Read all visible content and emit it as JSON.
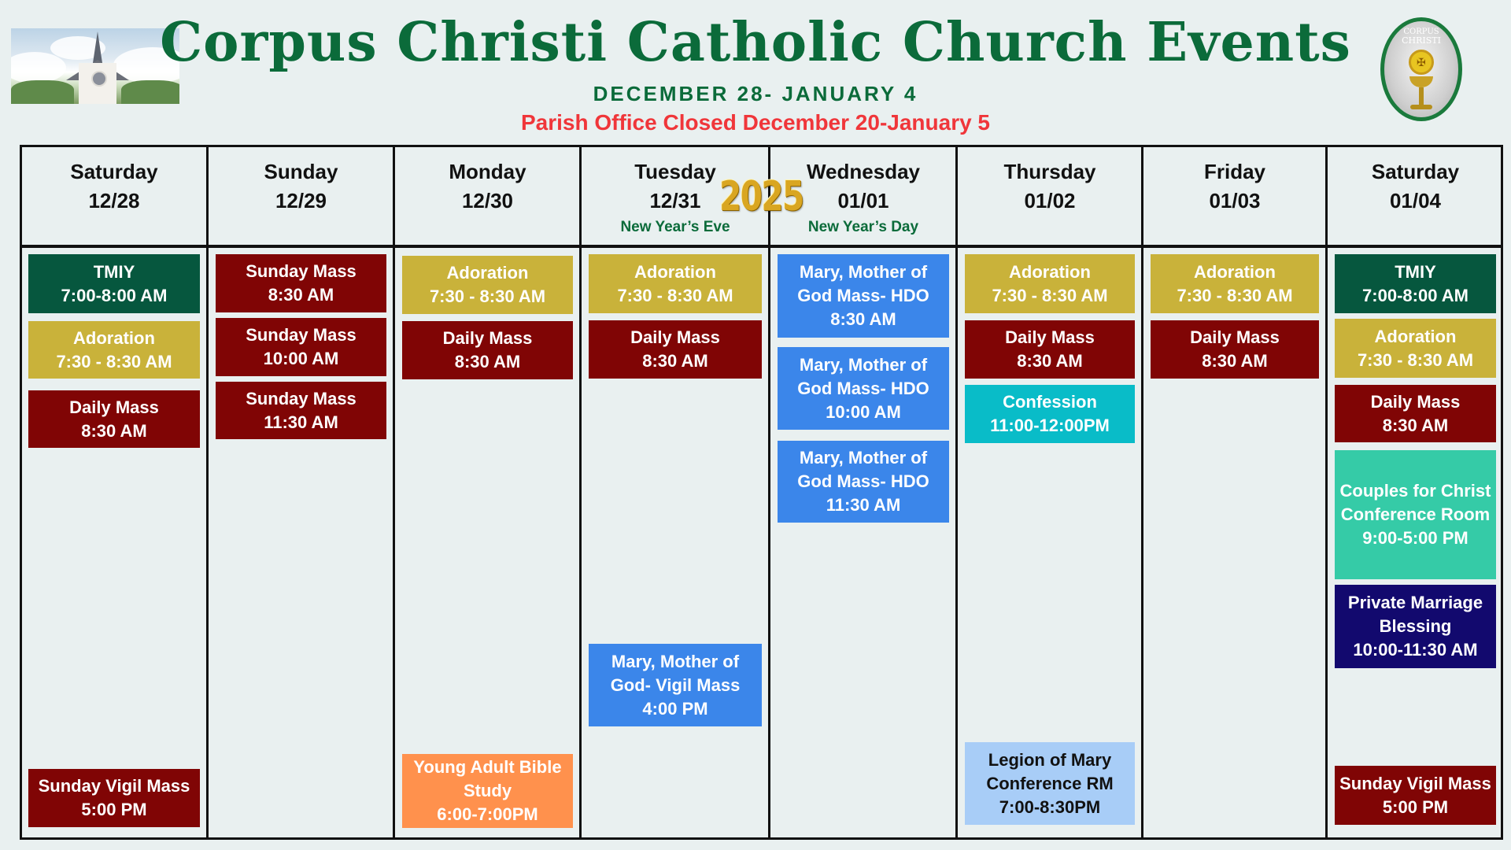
{
  "header": {
    "title": "Corpus Christi Catholic Church Events",
    "date_range": "DECEMBER 28- JANUARY 4",
    "office_notice": "Parish Office Closed December 20-January 5",
    "year_badge": "2025",
    "logo_text_top": "CORPUS",
    "logo_text_mid": "CHRISTI",
    "logo_host": "✠"
  },
  "colors": {
    "title_green": "#0b6b3a",
    "notice_red": "#f0363a",
    "tmiy": "#06573e",
    "adoration": "#c9b23a",
    "mass": "#800505",
    "holy_day_mass": "#3b86ea",
    "confession": "#09bcc8",
    "young_adult": "#ff914d",
    "legion": "#a8cdf7",
    "couples": "#35cba7",
    "private_blessing": "#12096e"
  },
  "days": [
    {
      "name": "Saturday",
      "date": "12/28",
      "holiday": "",
      "events": [
        {
          "title": "TMIY",
          "time": "7:00-8:00 AM",
          "type": "tmiy"
        },
        {
          "title": "Adoration",
          "time": "7:30 - 8:30 AM",
          "type": "adoration"
        },
        {
          "title": "Daily Mass",
          "time": "8:30 AM",
          "type": "mass"
        },
        {
          "title": "Sunday Vigil Mass",
          "time": "5:00 PM",
          "type": "mass"
        }
      ]
    },
    {
      "name": "Sunday",
      "date": "12/29",
      "holiday": "",
      "events": [
        {
          "title": "Sunday Mass",
          "time": "8:30 AM",
          "type": "mass"
        },
        {
          "title": "Sunday Mass",
          "time": "10:00 AM",
          "type": "mass"
        },
        {
          "title": "Sunday Mass",
          "time": "11:30 AM",
          "type": "mass"
        }
      ]
    },
    {
      "name": "Monday",
      "date": "12/30",
      "holiday": "",
      "events": [
        {
          "title": "Adoration",
          "time": "7:30 - 8:30 AM",
          "type": "adoration"
        },
        {
          "title": "Daily Mass",
          "time": "8:30 AM",
          "type": "mass"
        },
        {
          "title": "Young Adult Bible Study",
          "time": "6:00-7:00PM",
          "type": "young_adult"
        }
      ]
    },
    {
      "name": "Tuesday",
      "date": "12/31",
      "holiday": "New Year’s Eve",
      "events": [
        {
          "title": "Adoration",
          "time": "7:30 - 8:30 AM",
          "type": "adoration"
        },
        {
          "title": "Daily Mass",
          "time": "8:30 AM",
          "type": "mass"
        },
        {
          "title": "Mary, Mother of God- Vigil Mass",
          "time": "4:00 PM",
          "type": "holy_day_mass"
        }
      ]
    },
    {
      "name": "Wednesday",
      "date": "01/01",
      "holiday": "New Year’s Day",
      "events": [
        {
          "title": "Mary, Mother of God Mass- HDO",
          "time": "8:30 AM",
          "type": "holy_day_mass"
        },
        {
          "title": "Mary, Mother of God Mass- HDO",
          "time": "10:00 AM",
          "type": "holy_day_mass"
        },
        {
          "title": "Mary, Mother of God Mass- HDO",
          "time": "11:30 AM",
          "type": "holy_day_mass"
        }
      ]
    },
    {
      "name": "Thursday",
      "date": "01/02",
      "holiday": "",
      "events": [
        {
          "title": "Adoration",
          "time": "7:30 - 8:30 AM",
          "type": "adoration"
        },
        {
          "title": "Daily Mass",
          "time": "8:30 AM",
          "type": "mass"
        },
        {
          "title": "Confession",
          "time": "11:00-12:00PM",
          "type": "confession"
        },
        {
          "title": "Legion of Mary Conference RM",
          "time": "7:00-8:30PM",
          "type": "legion"
        }
      ]
    },
    {
      "name": "Friday",
      "date": "01/03",
      "holiday": "",
      "events": [
        {
          "title": "Adoration",
          "time": "7:30 - 8:30 AM",
          "type": "adoration"
        },
        {
          "title": "Daily Mass",
          "time": "8:30 AM",
          "type": "mass"
        }
      ]
    },
    {
      "name": "Saturday",
      "date": "01/04",
      "holiday": "",
      "events": [
        {
          "title": "TMIY",
          "time": "7:00-8:00 AM",
          "type": "tmiy"
        },
        {
          "title": "Adoration",
          "time": "7:30 - 8:30 AM",
          "type": "adoration"
        },
        {
          "title": "Daily Mass",
          "time": "8:30 AM",
          "type": "mass"
        },
        {
          "title": "Couples for Christ Conference Room",
          "time": "9:00-5:00 PM",
          "type": "couples"
        },
        {
          "title": "Private Marriage Blessing",
          "time": "10:00-11:30 AM",
          "type": "private_blessing"
        },
        {
          "title": "Sunday Vigil Mass",
          "time": "5:00 PM",
          "type": "mass"
        }
      ]
    }
  ]
}
